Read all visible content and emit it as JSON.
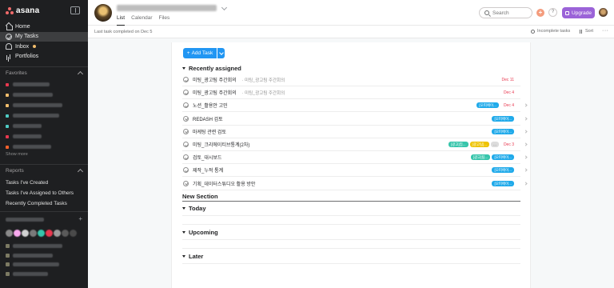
{
  "app": {
    "brand": "asana"
  },
  "sidebar": {
    "nav": [
      {
        "label": "Home",
        "icon": "home-icon"
      },
      {
        "label": "My Tasks",
        "icon": "check-circle-icon",
        "active": true
      },
      {
        "label": "Inbox",
        "icon": "bell-icon",
        "has_dot": true
      },
      {
        "label": "Portfolios",
        "icon": "bar-chart-icon"
      }
    ],
    "favorites_title": "Favorites",
    "favorites": [
      {
        "color": "#e8384f"
      },
      {
        "color": "#f1bd6c"
      },
      {
        "color": "#f1bd6c"
      },
      {
        "color": "#4ecbc4"
      },
      {
        "color": "#4ecbc4"
      },
      {
        "color": "#e8384f"
      },
      {
        "color": "#fd612c"
      }
    ],
    "show_more": "Show more",
    "reports_title": "Reports",
    "reports": [
      "Tasks I've Created",
      "Tasks I've Assigned to Others",
      "Recently Completed Tasks"
    ]
  },
  "topbar": {
    "tabs": [
      "List",
      "Calendar",
      "Files"
    ],
    "search_placeholder": "Search",
    "help_label": "?",
    "upgrade_label": "Upgrade"
  },
  "subbar": {
    "last_completed": "Last task completed on Dec 5",
    "incomplete_label": "Incomplete tasks",
    "sort_label": "Sort"
  },
  "main": {
    "add_task_label": "Add Task",
    "sections": {
      "recent": "Recently assigned",
      "new": "New Section",
      "today": "Today",
      "upcoming": "Upcoming",
      "later": "Later"
    },
    "tasks": [
      {
        "name": "미팅_광고팀 주간회의",
        "project": "· 미팅_광고팀 주간회의",
        "due": "Dec 11",
        "tags": []
      },
      {
        "name": "미팅_광고팀 주간회의",
        "project": "· 미팅_광고팀 주간회의",
        "due": "Dec 4",
        "tags": []
      },
      {
        "name": "노션_활용안 고민",
        "project": "",
        "due": "Dec 4",
        "tags": [
          {
            "label": "[오피에이...",
            "color": "#20aaea"
          }
        ]
      },
      {
        "name": "REDASH 검토",
        "project": "",
        "due": "",
        "tags": [
          {
            "label": "[오피에이...",
            "color": "#20aaea"
          }
        ]
      },
      {
        "name": "마케팅 관련 검토",
        "project": "",
        "due": "",
        "tags": [
          {
            "label": "[오피에이...",
            "color": "#20aaea"
          }
        ]
      },
      {
        "name": "미팅_크리에이티브통계(2차)",
        "project": "",
        "due": "Dec 3",
        "tags": [
          {
            "label": "[광고]집...",
            "color": "#37c5ab"
          },
          {
            "label": "[광고팀]...",
            "color": "#eec300"
          },
          {
            "label": "...",
            "color": "#dcdcdc"
          }
        ]
      },
      {
        "name": "검토_대시보드",
        "project": "",
        "due": "",
        "tags": [
          {
            "label": "[광고]팀...",
            "color": "#37c5ab"
          },
          {
            "label": "[오피에이...",
            "color": "#20aaea"
          }
        ]
      },
      {
        "name": "제작_누적 통계",
        "project": "",
        "due": "",
        "tags": [
          {
            "label": "[오피에이...",
            "color": "#20aaea"
          }
        ]
      },
      {
        "name": "기획_데이터스튜디오 활용 방안",
        "project": "",
        "due": "",
        "tags": [
          {
            "label": "[오피에이...",
            "color": "#20aaea"
          }
        ]
      }
    ]
  }
}
